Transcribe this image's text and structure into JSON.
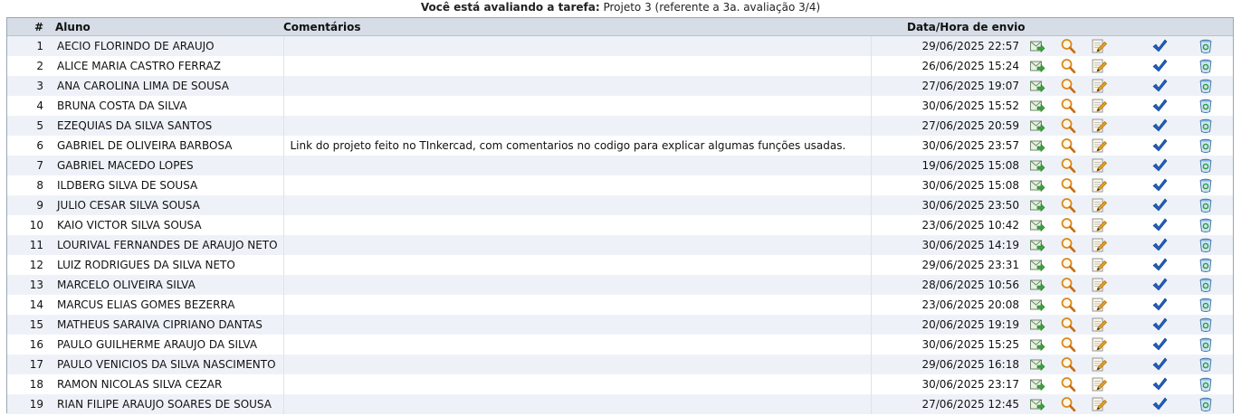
{
  "caption": {
    "prefix": "Você está avaliando a tarefa:",
    "task": "Projeto 3 (referente a 3a. avaliação 3/4)"
  },
  "columns": {
    "num": "#",
    "aluno": "Aluno",
    "comentarios": "Comentários",
    "data": "Data/Hora de envio"
  },
  "rows": [
    {
      "num": "1",
      "name": "AECIO FLORINDO DE ARAUJO",
      "comment": "",
      "date": "29/06/2025 22:57"
    },
    {
      "num": "2",
      "name": "ALICE MARIA CASTRO FERRAZ",
      "comment": "",
      "date": "26/06/2025 15:24"
    },
    {
      "num": "3",
      "name": "ANA CAROLINA LIMA DE SOUSA",
      "comment": "",
      "date": "27/06/2025 19:07"
    },
    {
      "num": "4",
      "name": "BRUNA COSTA DA SILVA",
      "comment": "",
      "date": "30/06/2025 15:52"
    },
    {
      "num": "5",
      "name": "EZEQUIAS DA SILVA SANTOS",
      "comment": "",
      "date": "27/06/2025 20:59"
    },
    {
      "num": "6",
      "name": "GABRIEL DE OLIVEIRA BARBOSA",
      "comment": "Link do projeto feito no TInkercad, com comentarios no codigo para explicar algumas funções usadas.",
      "date": "30/06/2025 23:57"
    },
    {
      "num": "7",
      "name": "GABRIEL MACEDO LOPES",
      "comment": "",
      "date": "19/06/2025 15:08"
    },
    {
      "num": "8",
      "name": "ILDBERG SILVA DE SOUSA",
      "comment": "",
      "date": "30/06/2025 15:08"
    },
    {
      "num": "9",
      "name": "JULIO CESAR SILVA SOUSA",
      "comment": "",
      "date": "30/06/2025 23:50"
    },
    {
      "num": "10",
      "name": "KAIO VICTOR SILVA SOUSA",
      "comment": "",
      "date": "23/06/2025 10:42"
    },
    {
      "num": "11",
      "name": "LOURIVAL FERNANDES DE ARAUJO NETO",
      "comment": "",
      "date": "30/06/2025 14:19"
    },
    {
      "num": "12",
      "name": "LUIZ RODRIGUES DA SILVA NETO",
      "comment": "",
      "date": "29/06/2025 23:31"
    },
    {
      "num": "13",
      "name": "MARCELO OLIVEIRA SILVA",
      "comment": "",
      "date": "28/06/2025 10:56"
    },
    {
      "num": "14",
      "name": "MARCUS ELIAS GOMES BEZERRA",
      "comment": "",
      "date": "23/06/2025 20:08"
    },
    {
      "num": "15",
      "name": "MATHEUS SARAIVA CIPRIANO DANTAS",
      "comment": "",
      "date": "20/06/2025 19:19"
    },
    {
      "num": "16",
      "name": "PAULO GUILHERME ARAUJO DA SILVA",
      "comment": "",
      "date": "30/06/2025 15:25"
    },
    {
      "num": "17",
      "name": "PAULO VENICIOS DA SILVA NASCIMENTO",
      "comment": "",
      "date": "29/06/2025 16:18"
    },
    {
      "num": "18",
      "name": "RAMON NICOLAS SILVA CEZAR",
      "comment": "",
      "date": "30/06/2025 23:17"
    },
    {
      "num": "19",
      "name": "RIAN FILIPE ARAUJO SOARES DE SOUSA",
      "comment": "",
      "date": "27/06/2025 12:45"
    }
  ],
  "row_icons": [
    "download-icon",
    "view-icon",
    "edit-grade-icon",
    "check-icon",
    "delete-icon"
  ],
  "colors": {
    "header_bg": "#d6dde6",
    "row_alt_bg": "#eef2f8",
    "border": "#9aa6b5",
    "check_blue": "#1f5fbf"
  }
}
